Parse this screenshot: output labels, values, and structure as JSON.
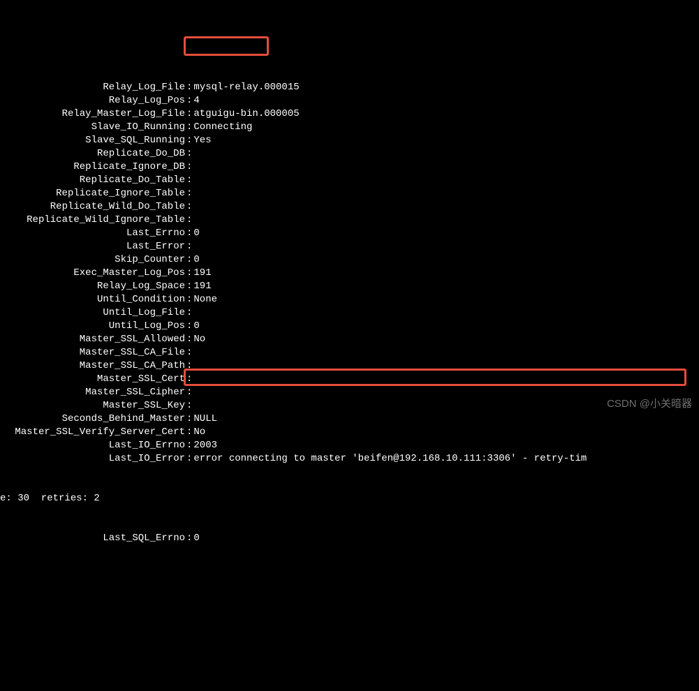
{
  "rows": [
    {
      "label": "Relay_Log_File",
      "value": "mysql-relay.000015"
    },
    {
      "label": "Relay_Log_Pos",
      "value": "4"
    },
    {
      "label": "Relay_Master_Log_File",
      "value": "atguigu-bin.000005"
    },
    {
      "label": "Slave_IO_Running",
      "value": "Connecting"
    },
    {
      "label": "Slave_SQL_Running",
      "value": "Yes"
    },
    {
      "label": "Replicate_Do_DB",
      "value": ""
    },
    {
      "label": "Replicate_Ignore_DB",
      "value": ""
    },
    {
      "label": "Replicate_Do_Table",
      "value": ""
    },
    {
      "label": "Replicate_Ignore_Table",
      "value": ""
    },
    {
      "label": "Replicate_Wild_Do_Table",
      "value": ""
    },
    {
      "label": "Replicate_Wild_Ignore_Table",
      "value": ""
    },
    {
      "label": "Last_Errno",
      "value": "0"
    },
    {
      "label": "Last_Error",
      "value": ""
    },
    {
      "label": "Skip_Counter",
      "value": "0"
    },
    {
      "label": "Exec_Master_Log_Pos",
      "value": "191"
    },
    {
      "label": "Relay_Log_Space",
      "value": "191"
    },
    {
      "label": "Until_Condition",
      "value": "None"
    },
    {
      "label": "Until_Log_File",
      "value": ""
    },
    {
      "label": "Until_Log_Pos",
      "value": "0"
    },
    {
      "label": "Master_SSL_Allowed",
      "value": "No"
    },
    {
      "label": "Master_SSL_CA_File",
      "value": ""
    },
    {
      "label": "Master_SSL_CA_Path",
      "value": ""
    },
    {
      "label": "Master_SSL_Cert",
      "value": ""
    },
    {
      "label": "Master_SSL_Cipher",
      "value": ""
    },
    {
      "label": "Master_SSL_Key",
      "value": ""
    },
    {
      "label": "Seconds_Behind_Master",
      "value": "NULL"
    },
    {
      "label": "Master_SSL_Verify_Server_Cert",
      "value": "No"
    },
    {
      "label": "Last_IO_Errno",
      "value": "2003"
    },
    {
      "label": "Last_IO_Error",
      "value": "error connecting to master 'beifen@192.168.10.111:3306' - retry-tim"
    }
  ],
  "continuation": "e: 30  retries: 2",
  "last_row": {
    "label": "Last_SQL_Errno",
    "value": "0"
  },
  "watermark": "CSDN @小关暗器"
}
